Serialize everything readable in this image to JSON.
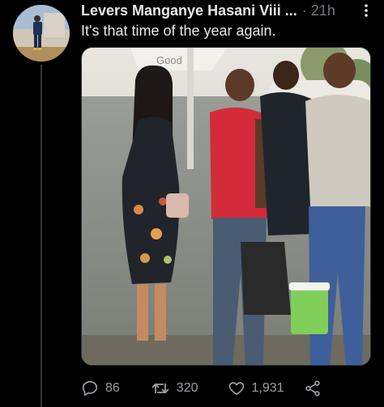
{
  "tweet": {
    "author": "Levers Manganye Hasani Viii ...",
    "separator": "·",
    "time": "21h",
    "text": "It's that time of the year again.",
    "photo": {
      "sign_text": "Good"
    }
  },
  "actions": {
    "replies": "86",
    "retweets": "320",
    "likes": "1,931"
  },
  "icons": {
    "more": "more-vertical-icon",
    "reply": "reply-icon",
    "retweet": "retweet-icon",
    "like": "heart-icon",
    "share": "share-icon"
  },
  "colors": {
    "background": "#000000",
    "text": "#e7e9ea",
    "muted": "#71767b",
    "divider": "#333639"
  }
}
